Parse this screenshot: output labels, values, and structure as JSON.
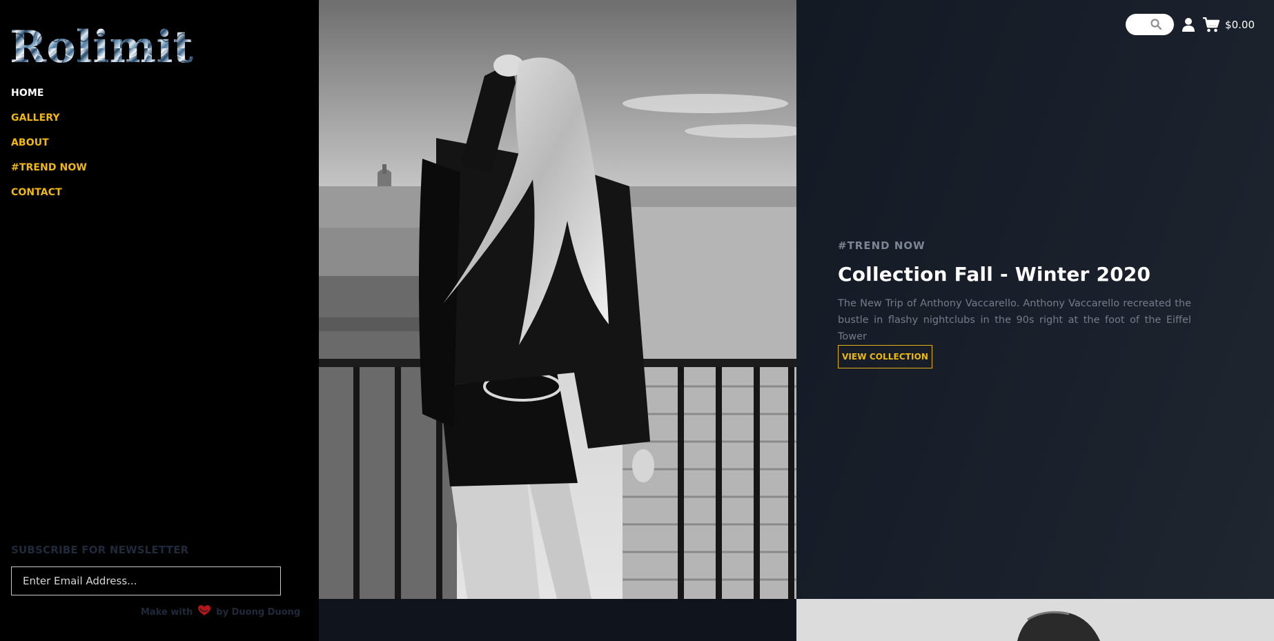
{
  "brand": {
    "logo_text": "Rolimit"
  },
  "nav": {
    "items": [
      {
        "label": "HOME",
        "active": true
      },
      {
        "label": "GALLERY",
        "active": false
      },
      {
        "label": "ABOUT",
        "active": false
      },
      {
        "label": "#TREND NOW",
        "active": false
      },
      {
        "label": "CONTACT",
        "active": false
      }
    ]
  },
  "newsletter": {
    "title": "SUBSCRIBE FOR NEWSLETTER",
    "placeholder": "Enter Email Address...",
    "credit_prefix": "Make with",
    "credit_suffix": "by Duong Duong"
  },
  "header": {
    "search_icon": "search-icon",
    "user_icon": "user-icon",
    "cart_icon": "cart-icon",
    "cart_total": "$0.00"
  },
  "hero": {
    "eyebrow": "#TREND NOW",
    "title": "Collection Fall - Winter 2020",
    "description": "The New Trip of Anthony Vaccarello. Anthony Vaccarello recreated the bustle in flashy nightclubs in the 90s right at the foot of the Eiffel Tower",
    "button_label": "VIEW COLLECTION"
  },
  "colors": {
    "accent": "#f0b90b",
    "sidebar_bg": "#000000",
    "panel_bg": "#1a202b",
    "muted_text": "#737d8a"
  }
}
